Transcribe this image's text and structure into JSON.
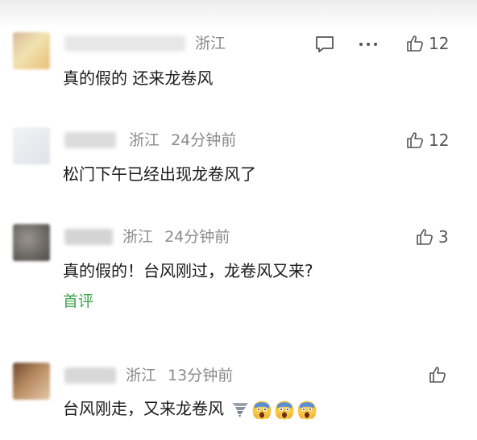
{
  "comments": [
    {
      "location": "浙江",
      "time": "",
      "text": "真的假的 还来龙卷风",
      "likes": "12",
      "has_reply": true,
      "has_more": true
    },
    {
      "location": "浙江",
      "time": "24分钟前",
      "text": "松门下午已经出现龙卷风了",
      "likes": "12"
    },
    {
      "location": "浙江",
      "time": "24分钟前",
      "text": "真的假的！台风刚过，龙卷风又来?",
      "likes": "3",
      "badge": "首评"
    },
    {
      "location": "浙江",
      "time": "13分钟前",
      "text": "台风刚走，又来龙卷风",
      "likes": "",
      "emojis": [
        "tornado-emoji",
        "scream-emoji",
        "scream-emoji",
        "scream-emoji"
      ]
    }
  ],
  "colors": {
    "text": "#1a1a1a",
    "meta": "#8a8a8a",
    "badge": "#3fa24e",
    "icon": "#555555"
  }
}
